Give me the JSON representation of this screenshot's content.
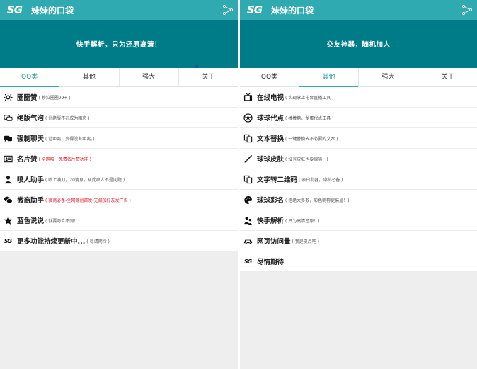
{
  "app": {
    "logo": "SG",
    "title": "妹妹的口袋"
  },
  "left": {
    "banner": "快手解析，只为还原高清！",
    "tabs": [
      {
        "label": "QQ类",
        "active": true
      },
      {
        "label": "其他",
        "active": false
      },
      {
        "label": "强大",
        "active": false
      },
      {
        "label": "关于",
        "active": false
      }
    ],
    "items": [
      {
        "name": "圈圈赞",
        "desc": "( 秒拉圈圈99+ )",
        "icon": "sun-icon",
        "red": false
      },
      {
        "name": "绝版气泡",
        "desc": "( 让绝版不在成为暗恋 )",
        "icon": "chat-bubble-icon",
        "red": false
      },
      {
        "name": "强制聊天",
        "desc": "( 让距离，变得没有距离。)",
        "icon": "chat-icon",
        "red": false
      },
      {
        "name": "名片赞",
        "desc": "( 全网唯一免费名片赞功能 )",
        "icon": "id-card-icon",
        "red": true
      },
      {
        "name": "喷人助手",
        "desc": "( 喷上满刀，20消息，从此喷人不是问题 )",
        "icon": "user-icon",
        "red": false
      },
      {
        "name": "微商助手",
        "desc": "( 微商必备-全网源创首发-无漏加好友发广告 )",
        "icon": "message-icon",
        "red": true
      },
      {
        "name": "蓝色说说",
        "desc": "( 就要与众不同！)",
        "icon": "star-icon",
        "red": false
      },
      {
        "name": "更多功能持续更新中...",
        "desc": "( 尽请期待 )",
        "icon": "sg-logo-icon",
        "red": false
      }
    ]
  },
  "right": {
    "banner": "交友神器，随机加人",
    "tabs": [
      {
        "label": "QQ类",
        "active": false
      },
      {
        "label": "其他",
        "active": true
      },
      {
        "label": "强大",
        "active": false
      },
      {
        "label": "关于",
        "active": false
      }
    ],
    "items": [
      {
        "name": "在线电视",
        "desc": "( 实现掌上电台直播工具 )",
        "icon": "tv-icon",
        "red": false
      },
      {
        "name": "球球代点",
        "desc": "( 棒棒糖，龙蛋代点工具 )",
        "icon": "soccer-ball-icon",
        "red": false
      },
      {
        "name": "文本替换",
        "desc": "( 一键替换去不必要的文本 )",
        "icon": "copy-icon",
        "red": false
      },
      {
        "name": "球球皮肤",
        "desc": "( 没有皮肤也要很骚！)",
        "icon": "brush-icon",
        "red": false
      },
      {
        "name": "文字转二维码",
        "desc": "( 表白利器，隐私必备 )",
        "icon": "copy-icon",
        "red": false
      },
      {
        "name": "球球彩名",
        "desc": "( 拒绝大多数，彩色昵称更装逼！)",
        "icon": "palette-icon",
        "red": false
      },
      {
        "name": "快手解析",
        "desc": "( 只为高清还原！)",
        "icon": "people-icon",
        "red": false
      },
      {
        "name": "网页访问量",
        "desc": "( 我是皮点吧 )",
        "icon": "car-icon",
        "red": false
      },
      {
        "name": "尽情期待",
        "desc": "",
        "icon": "sg-logo-icon",
        "red": false
      }
    ]
  }
}
